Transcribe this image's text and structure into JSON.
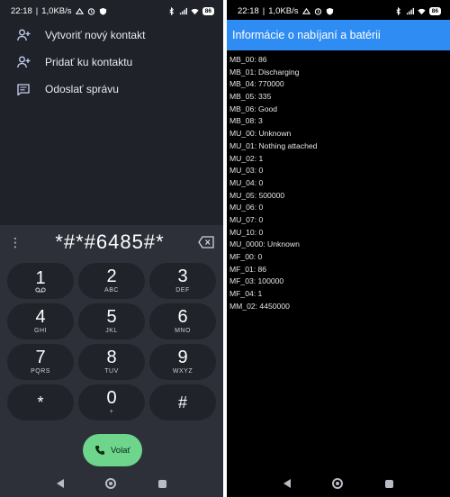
{
  "left": {
    "status": {
      "time": "22:18",
      "speed": "1,0KB/s",
      "battery": "86"
    },
    "menu": [
      {
        "label": "Vytvoriť nový kontakt",
        "icon": "person-add-icon"
      },
      {
        "label": "Pridať ku kontaktu",
        "icon": "person-add-icon"
      },
      {
        "label": "Odoslať správu",
        "icon": "message-icon"
      }
    ],
    "dialer": {
      "number": "*#*#6485#*",
      "keys": [
        {
          "digit": "1",
          "letters": ""
        },
        {
          "digit": "2",
          "letters": "ABC"
        },
        {
          "digit": "3",
          "letters": "DEF"
        },
        {
          "digit": "4",
          "letters": "GHI"
        },
        {
          "digit": "5",
          "letters": "JKL"
        },
        {
          "digit": "6",
          "letters": "MNO"
        },
        {
          "digit": "7",
          "letters": "PQRS"
        },
        {
          "digit": "8",
          "letters": "TUV"
        },
        {
          "digit": "9",
          "letters": "WXYZ"
        },
        {
          "digit": "*",
          "letters": ""
        },
        {
          "digit": "0",
          "letters": "+"
        },
        {
          "digit": "#",
          "letters": ""
        }
      ],
      "call_label": "Volať",
      "call_color": "#6dd58c"
    }
  },
  "right": {
    "status": {
      "time": "22:18",
      "speed": "1,0KB/s",
      "battery": "86"
    },
    "title": "Informácie o nabíjaní a batérii",
    "accent": "#2f8cf2",
    "lines": [
      "MB_00: 86",
      "MB_01: Discharging",
      "MB_04: 770000",
      "MB_05: 335",
      "MB_06: Good",
      "MB_08: 3",
      "MU_00: Unknown",
      "MU_01: Nothing attached",
      "MU_02: 1",
      "MU_03: 0",
      "MU_04: 0",
      "MU_05: 500000",
      "MU_06: 0",
      "MU_07: 0",
      "MU_10: 0",
      "MU_0000: Unknown",
      "MF_00: 0",
      "MF_01: 86",
      "MF_03: 100000",
      "MF_04: 1",
      "MM_02: 4450000"
    ]
  }
}
